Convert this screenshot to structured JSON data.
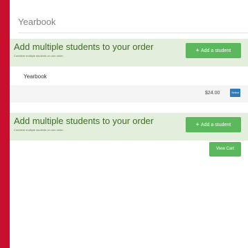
{
  "page": {
    "section_title": "Yearbook"
  },
  "multi_student": {
    "title": "Add multiple students to your order",
    "subtitle": "Combine multiple students on one order.",
    "add_button_icon": "+",
    "add_button_label": "Add a student"
  },
  "product": {
    "name": "Yearbook",
    "price": "$24.00",
    "select_label": "Select"
  },
  "cart": {
    "view_cart_label": "View Cart"
  },
  "colors": {
    "background_red": "#c8102e",
    "green_button": "#5cb85c",
    "blue_button": "#337ab7",
    "green_box": "#e4eedd"
  }
}
